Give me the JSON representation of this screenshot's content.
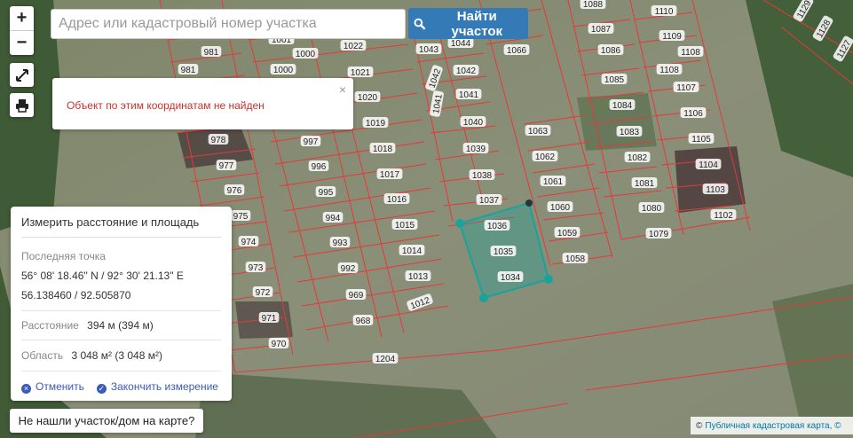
{
  "search": {
    "placeholder": "Адрес или кадастровый номер участка",
    "button_label": "Найти участок"
  },
  "controls": {
    "zoom_in": "+",
    "zoom_out": "−"
  },
  "alert": {
    "message": "Объект по этим координатам не найден",
    "close": "×"
  },
  "measure": {
    "title": "Измерить расстояние и площадь",
    "last_point_label": "Последняя точка",
    "last_point_dms": "56° 08' 18.46\" N / 92° 30' 21.13\" E",
    "last_point_decimal": "56.138460 / 92.505870",
    "distance_label": "Расстояние",
    "distance_value": "394 м (394 м)",
    "area_label": "Область",
    "area_value": "3 048 м² (3 048 м²)",
    "cancel_label": "Отменить",
    "finish_label": "Закончить измерение"
  },
  "not_found_label": "Не нашли участок/дом на карте?",
  "attribution": {
    "symbol": "©",
    "link": "Публичная кадастровая карта, ©"
  },
  "colors": {
    "parcel_border": "#e8373a",
    "measure_polygon": "#1aa39a",
    "button": "#337ab7"
  },
  "parcels": [
    {
      "label": "1088"
    },
    {
      "label": "1110"
    },
    {
      "label": "1087"
    },
    {
      "label": "1109"
    },
    {
      "label": "1086"
    },
    {
      "label": "1108"
    },
    {
      "label": "1108"
    },
    {
      "label": "1085"
    },
    {
      "label": "1107"
    },
    {
      "label": "1084"
    },
    {
      "label": "1106"
    },
    {
      "label": "1083"
    },
    {
      "label": "1105"
    },
    {
      "label": "1082"
    },
    {
      "label": "1104"
    },
    {
      "label": "1081"
    },
    {
      "label": "1103"
    },
    {
      "label": "1080"
    },
    {
      "label": "1102"
    },
    {
      "label": "1079"
    },
    {
      "label": "1066"
    },
    {
      "label": "1063"
    },
    {
      "label": "1062"
    },
    {
      "label": "1061"
    },
    {
      "label": "1060"
    },
    {
      "label": "1059"
    },
    {
      "label": "1058"
    },
    {
      "label": "1043"
    },
    {
      "label": "1044"
    },
    {
      "label": "1042"
    },
    {
      "label": "1042"
    },
    {
      "label": "1041"
    },
    {
      "label": "1041"
    },
    {
      "label": "1040"
    },
    {
      "label": "1039"
    },
    {
      "label": "1038"
    },
    {
      "label": "1037"
    },
    {
      "label": "1036"
    },
    {
      "label": "1035"
    },
    {
      "label": "1034"
    },
    {
      "label": "1022"
    },
    {
      "label": "1021"
    },
    {
      "label": "1020"
    },
    {
      "label": "1019"
    },
    {
      "label": "1018"
    },
    {
      "label": "1017"
    },
    {
      "label": "1016"
    },
    {
      "label": "1015"
    },
    {
      "label": "1014"
    },
    {
      "label": "1013"
    },
    {
      "label": "1012"
    },
    {
      "label": "1000"
    },
    {
      "label": "1001"
    },
    {
      "label": "1000"
    },
    {
      "label": "997"
    },
    {
      "label": "996"
    },
    {
      "label": "995"
    },
    {
      "label": "994"
    },
    {
      "label": "993"
    },
    {
      "label": "992"
    },
    {
      "label": "969"
    },
    {
      "label": "968"
    },
    {
      "label": "981"
    },
    {
      "label": "981"
    },
    {
      "label": "978"
    },
    {
      "label": "977"
    },
    {
      "label": "976"
    },
    {
      "label": "975"
    },
    {
      "label": "974"
    },
    {
      "label": "973"
    },
    {
      "label": "972"
    },
    {
      "label": "971"
    },
    {
      "label": "970"
    },
    {
      "label": "1204"
    },
    {
      "label": "1129"
    },
    {
      "label": "1128"
    },
    {
      "label": "1127"
    }
  ]
}
